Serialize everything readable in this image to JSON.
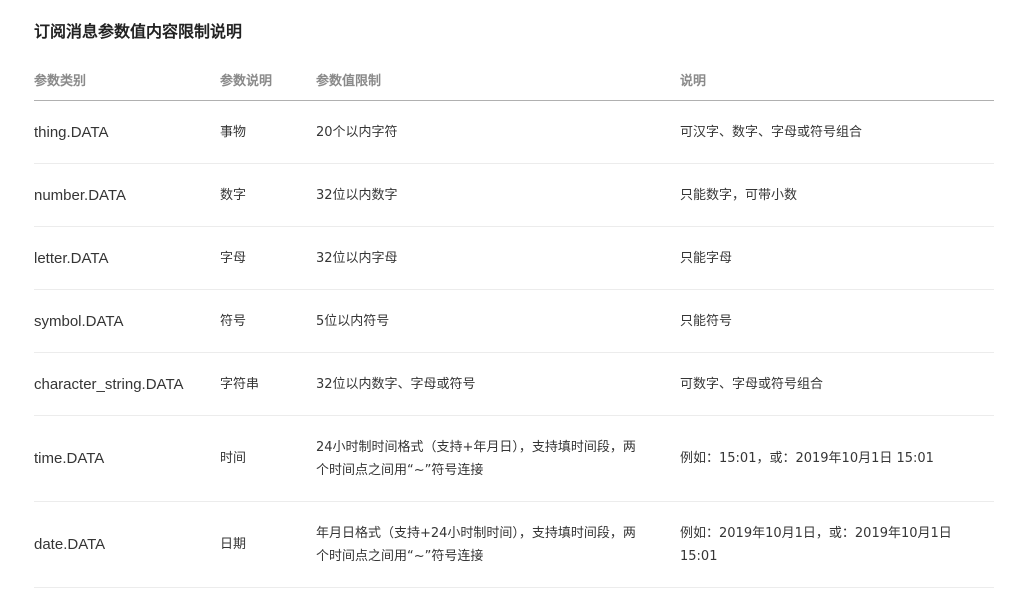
{
  "title": "订阅消息参数值内容限制说明",
  "columns": {
    "type": "参数类别",
    "desc": "参数说明",
    "limit": "参数值限制",
    "note": "说明"
  },
  "rows": [
    {
      "type": "thing.DATA",
      "desc": "事物",
      "limit": "20个以内字符",
      "note": "可汉字、数字、字母或符号组合"
    },
    {
      "type": "number.DATA",
      "desc": "数字",
      "limit": "32位以内数字",
      "note": "只能数字，可带小数"
    },
    {
      "type": "letter.DATA",
      "desc": "字母",
      "limit": "32位以内字母",
      "note": "只能字母"
    },
    {
      "type": "symbol.DATA",
      "desc": "符号",
      "limit": "5位以内符号",
      "note": "只能符号"
    },
    {
      "type": "character_string.DATA",
      "desc": "字符串",
      "limit": "32位以内数字、字母或符号",
      "note": "可数字、字母或符号组合"
    },
    {
      "type": "time.DATA",
      "desc": "时间",
      "limit": "24小时制时间格式（支持+年月日），支持填时间段，两个时间点之间用“~”符号连接",
      "note": "例如：15:01，或：2019年10月1日 15:01"
    },
    {
      "type": "date.DATA",
      "desc": "日期",
      "limit": "年月日格式（支持+24小时制时间），支持填时间段，两个时间点之间用“~”符号连接",
      "note": "例如：2019年10月1日，或：2019年10月1日 15:01"
    }
  ]
}
